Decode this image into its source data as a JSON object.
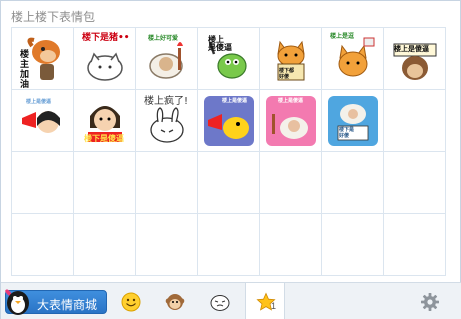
{
  "panel": {
    "title": "楼上楼下表情包"
  },
  "stickers": [
    {
      "name": "sticker-1",
      "caption": "楼\n主\n加\n油"
    },
    {
      "name": "sticker-2",
      "caption": "楼下是猪••"
    },
    {
      "name": "sticker-3",
      "caption": "楼上好可爱"
    },
    {
      "name": "sticker-4",
      "caption": "楼上\n是傻逼"
    },
    {
      "name": "sticker-5",
      "caption": "楼下都\n好傻"
    },
    {
      "name": "sticker-6",
      "caption": "楼上是逗"
    },
    {
      "name": "sticker-7",
      "caption": "楼上是傻逼"
    },
    {
      "name": "sticker-8",
      "caption": "楼上是傻逼"
    },
    {
      "name": "sticker-9",
      "caption": "楼下是傻逼"
    },
    {
      "name": "sticker-10",
      "caption": "楼上疯了!"
    },
    {
      "name": "sticker-11",
      "caption": "楼上是傻逼"
    },
    {
      "name": "sticker-12",
      "caption": "楼上是傻逼"
    },
    {
      "name": "sticker-13",
      "caption": "楼下是\n好傻"
    }
  ],
  "toolbar": {
    "store_label": "大表情商城",
    "favorites_count": "1"
  },
  "colors": {
    "accent": "#2a74c6",
    "grid_line": "#dbe5ef",
    "toolbar_bg": "#eef2f6"
  }
}
